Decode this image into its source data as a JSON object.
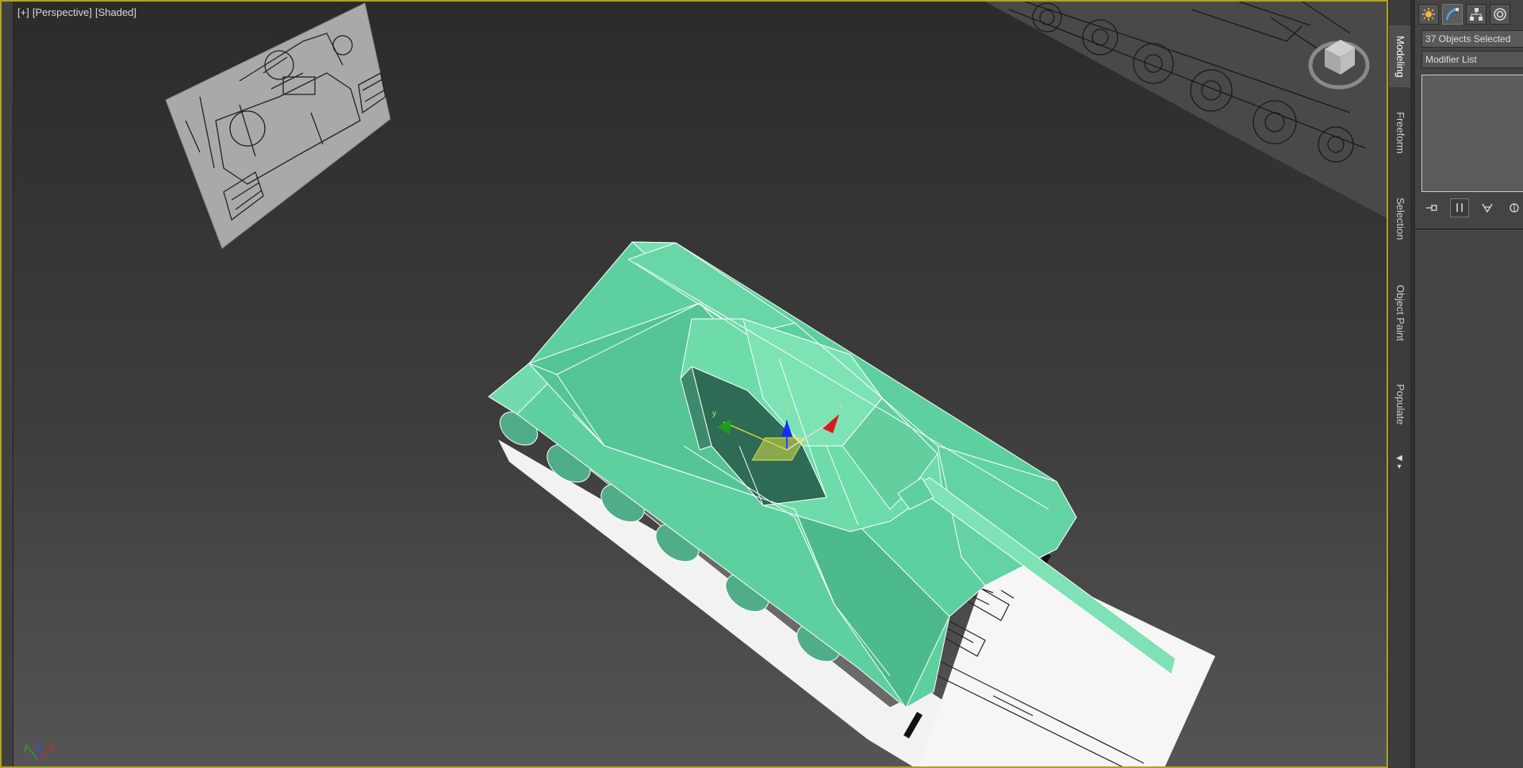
{
  "viewport": {
    "labels": [
      "[+]",
      "[Perspective]",
      "[Shaded]"
    ],
    "selection_color": "#b5a21c",
    "model_color": "#5ed3a0",
    "gizmo_axes": [
      "x",
      "y",
      "z"
    ],
    "tripod_axes": [
      "x",
      "y",
      "z"
    ]
  },
  "ribbon_tabs": [
    {
      "label": "Modeling",
      "active": true
    },
    {
      "label": "Freeform",
      "active": false
    },
    {
      "label": "Selection",
      "active": false
    },
    {
      "label": "Object Paint",
      "active": false
    },
    {
      "label": "Populate",
      "active": false
    }
  ],
  "command_panel": {
    "tab_icons": [
      "create-icon",
      "modify-icon",
      "hierarchy-icon",
      "motion-icon"
    ],
    "selection_field": "37 Objects Selected",
    "modifier_list": "Modifier List",
    "stack_tools": [
      "pin-stack-icon",
      "show-end-result-icon",
      "make-unique-icon",
      "remove-modifier-icon"
    ]
  }
}
